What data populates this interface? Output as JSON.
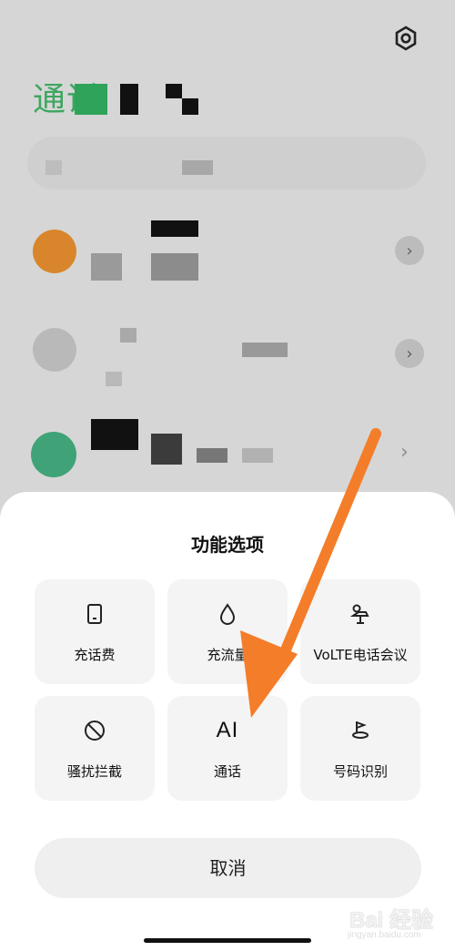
{
  "header": {
    "title": "通话"
  },
  "sheet": {
    "title": "功能选项",
    "options": [
      {
        "label": "充话费",
        "icon": "phone-card-icon"
      },
      {
        "label": "充流量",
        "icon": "droplet-icon"
      },
      {
        "label": "VoLTE电话会议",
        "icon": "video-conference-icon"
      },
      {
        "label": "骚扰拦截",
        "icon": "block-icon"
      },
      {
        "label": "通话",
        "icon": "ai-text-icon",
        "icon_text": "AI"
      },
      {
        "label": "号码识别",
        "icon": "pin-flag-icon"
      }
    ],
    "cancel": "取消"
  },
  "watermark": {
    "main": "Bai 经验",
    "sub": "jingyan.baidu.com"
  },
  "colors": {
    "arrow": "#f47d2a",
    "title_green": "#3da65f",
    "sheet_bg": "#ffffff",
    "tile_bg": "#f4f4f4"
  }
}
